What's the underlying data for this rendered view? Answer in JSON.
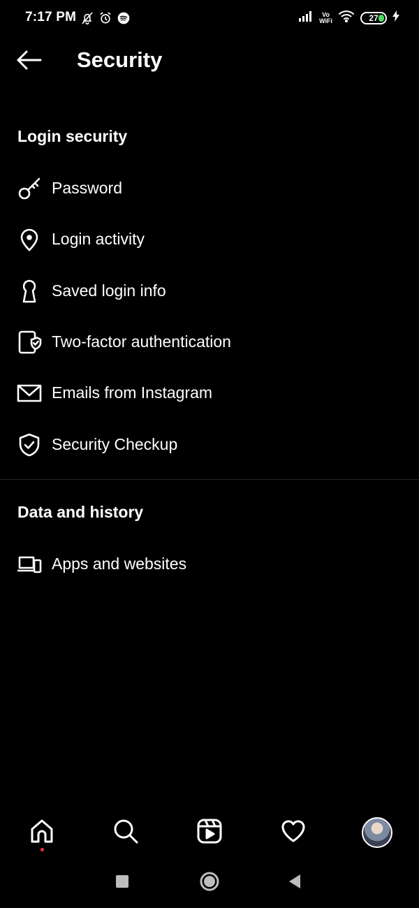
{
  "status_bar": {
    "time": "7:17 PM",
    "battery": "27",
    "vowifi_top": "Vo",
    "vowifi_bottom": "WiFi",
    "left_icons": [
      "mute-icon",
      "alarm-icon",
      "spotify-icon"
    ],
    "right_icons": [
      "signal-icon",
      "vowifi-icon",
      "wifi-icon",
      "battery-icon",
      "charging-icon"
    ]
  },
  "header": {
    "title": "Security",
    "back_icon": "arrow-left-icon"
  },
  "sections": [
    {
      "title": "Login security",
      "items": [
        {
          "label": "Password",
          "icon": "key-icon"
        },
        {
          "label": "Login activity",
          "icon": "location-pin-icon"
        },
        {
          "label": "Saved login info",
          "icon": "keyhole-icon"
        },
        {
          "label": "Two-factor authentication",
          "icon": "phone-shield-icon"
        },
        {
          "label": "Emails from Instagram",
          "icon": "envelope-icon"
        },
        {
          "label": "Security Checkup",
          "icon": "shield-check-icon"
        }
      ]
    },
    {
      "title": "Data and history",
      "items": [
        {
          "label": "Apps and websites",
          "icon": "devices-icon"
        }
      ]
    }
  ],
  "bottom_nav": [
    "home-icon",
    "search-icon",
    "reels-icon",
    "heart-icon",
    "profile-avatar"
  ],
  "system_nav": [
    "recents-icon",
    "home-circle-icon",
    "back-triangle-icon"
  ],
  "colors": {
    "background": "#000000",
    "text": "#ffffff",
    "divider": "#262626",
    "notification_dot": "#ff3040",
    "battery_fill": "#4cd964"
  }
}
